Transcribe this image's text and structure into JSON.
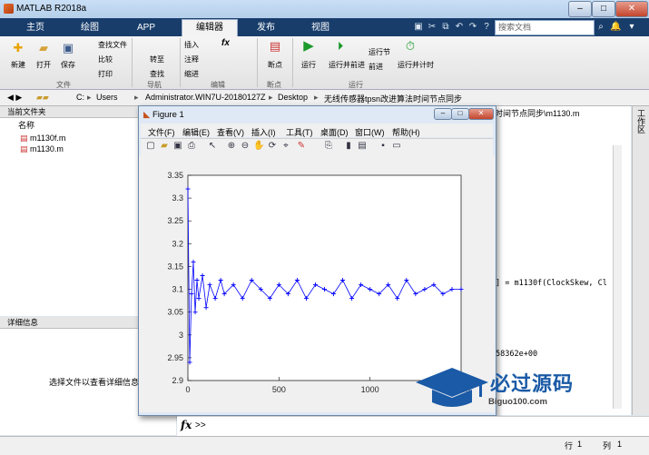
{
  "window": {
    "title": "MATLAB R2018a"
  },
  "ribbon_tabs": [
    "主页",
    "绘图",
    "APP",
    "编辑器",
    "发布",
    "视图"
  ],
  "search_placeholder": "搜索文档",
  "ribbon": {
    "new": "新建",
    "open": "打开",
    "save": "保存",
    "find_files": "查找文件",
    "compare": "比较",
    "print": "打印",
    "go_to": "转至",
    "find": "查找",
    "insert": "插入",
    "comment": "注释",
    "indent": "缩进",
    "fx": "fx",
    "breakpoint": "断点",
    "run": "运行",
    "run_and_advance": "运行并前进",
    "run_section": "运行节",
    "advance": "前进",
    "run_and_time": "运行并计时",
    "groups": {
      "file": "文件",
      "navigate": "导航",
      "edit": "编辑",
      "breakpoints": "断点",
      "run": "运行"
    }
  },
  "address_bar": {
    "segments": [
      "C:",
      "Users",
      "Administrator.WIN7U-20180127Z",
      "Desktop",
      "无线传感器tpsn改进算法时间节点同步"
    ]
  },
  "current_folder": {
    "title": "当前文件夹",
    "column_name": "名称",
    "files": [
      "m1130f.m",
      "m1130.m"
    ]
  },
  "details": {
    "title": "详细信息",
    "hint": "选择文件以查看详细信息"
  },
  "editor_side": {
    "tab_tail": "时间节点同步\\m1130.m",
    "code_line": "] =  m1130f(ClockSkew, Cl",
    "value_line": "58362e+00",
    "workspace_label": "工作区"
  },
  "figure": {
    "title": "Figure 1",
    "menus": [
      "文件(F)",
      "编辑(E)",
      "查看(V)",
      "插入(I)",
      "工具(T)",
      "桌面(D)",
      "窗口(W)",
      "帮助(H)"
    ]
  },
  "chart_data": {
    "type": "line",
    "title": "",
    "xlabel": "",
    "ylabel": "",
    "xlim": [
      0,
      1500
    ],
    "ylim": [
      2.9,
      3.35
    ],
    "xticks": [
      0,
      500,
      1000,
      1500
    ],
    "yticks": [
      2.9,
      2.95,
      3.0,
      3.05,
      3.1,
      3.15,
      3.2,
      3.25,
      3.3,
      3.35
    ],
    "marker": "+",
    "line_color": "#0000ff",
    "series": [
      {
        "x": [
          0,
          10,
          20,
          30,
          40,
          50,
          60,
          80,
          100,
          120,
          150,
          180,
          200,
          250,
          300,
          350,
          400,
          450,
          500,
          550,
          600,
          650,
          700,
          750,
          800,
          850,
          900,
          950,
          1000,
          1050,
          1100,
          1150,
          1200,
          1250,
          1300,
          1350,
          1400,
          1450,
          1500
        ],
        "y": [
          3.32,
          2.94,
          3.09,
          3.16,
          3.05,
          3.12,
          3.08,
          3.13,
          3.06,
          3.11,
          3.08,
          3.12,
          3.09,
          3.11,
          3.08,
          3.12,
          3.1,
          3.08,
          3.11,
          3.09,
          3.12,
          3.08,
          3.11,
          3.1,
          3.09,
          3.12,
          3.08,
          3.11,
          3.1,
          3.09,
          3.11,
          3.08,
          3.12,
          3.09,
          3.1,
          3.11,
          3.09,
          3.1,
          3.1
        ]
      }
    ]
  },
  "command": {
    "prompt_symbol": "fx",
    "prompt": ">>"
  },
  "status": {
    "row_label": "行",
    "row": "1",
    "col_label": "列",
    "col": "1"
  },
  "watermark": {
    "title": "必过源码",
    "url": "Biguo100.com"
  },
  "colors": {
    "ribbon_tabbar": "#183d6b",
    "plot_line": "#0000ff",
    "watermark": "#1a5aa6"
  }
}
